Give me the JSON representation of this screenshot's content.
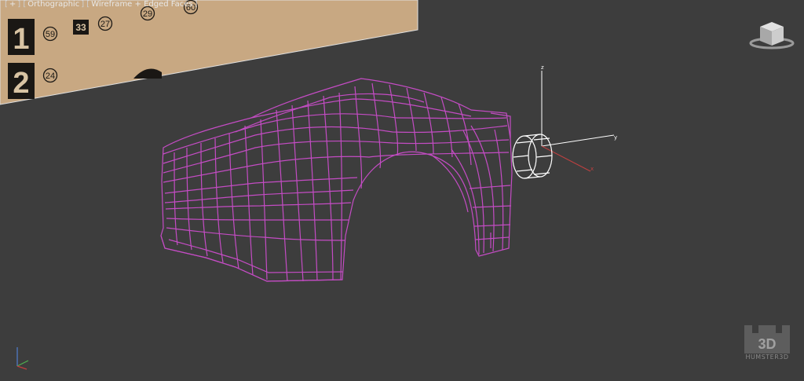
{
  "viewport": {
    "label": {
      "menu": "+",
      "view": "Orthographic",
      "shading": "Wireframe + Edged Faces"
    }
  },
  "reference_sheet": {
    "large_digits": [
      "1",
      "2"
    ],
    "circled_numbers": [
      "59",
      "24",
      "33",
      "27",
      "29",
      "60"
    ]
  },
  "gizmo": {
    "axis_x": "x",
    "axis_y": "y",
    "axis_z": "z"
  },
  "watermark": {
    "logo_text": "3D",
    "brand": "HUMSTER3D"
  },
  "colors": {
    "viewport_bg": "#3d3d3d",
    "wireframe": "#c44cc4",
    "reference_sheet": "#c9a884",
    "axis_x": "#c04040",
    "gizmo_white": "#ffffff"
  },
  "icons": [
    "viewcube-icon",
    "axis-tripod-icon",
    "transform-gizmo-icon"
  ]
}
